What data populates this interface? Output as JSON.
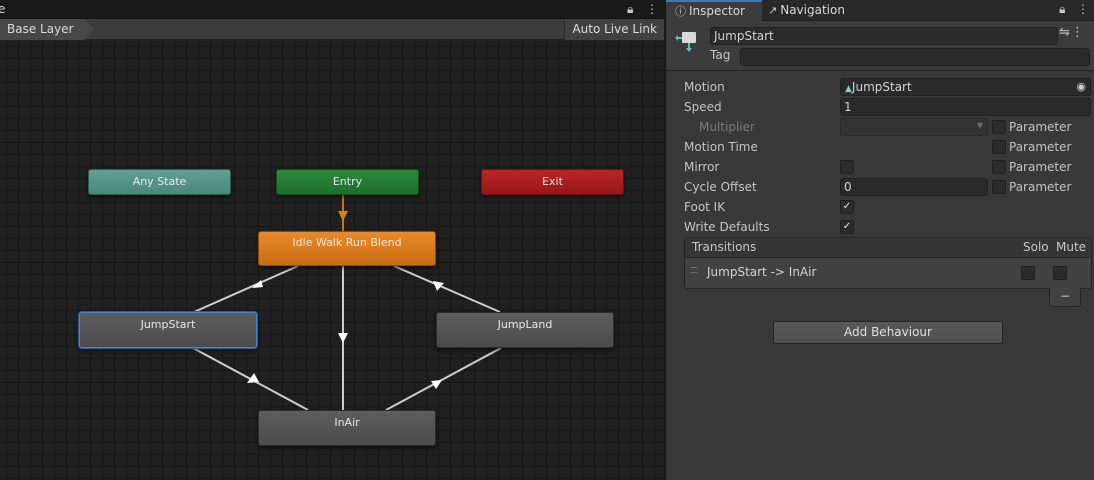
{
  "animator": {
    "tab_title": "e",
    "breadcrumb": "Base Layer",
    "auto_live_link": "Auto Live Link",
    "nodes": {
      "any_state": "Any State",
      "entry": "Entry",
      "exit": "Exit",
      "idle_walk_run": "Idle Walk Run Blend",
      "jump_start": "JumpStart",
      "jump_land": "JumpLand",
      "in_air": "InAir"
    }
  },
  "inspector": {
    "tab_inspector": "Inspector",
    "tab_navigation": "Navigation",
    "name": "JumpStart",
    "tag_label": "Tag",
    "tag_value": "",
    "props": {
      "motion_label": "Motion",
      "motion_value": "JumpStart",
      "speed_label": "Speed",
      "speed_value": "1",
      "multiplier_label": "Multiplier",
      "motion_time_label": "Motion Time",
      "mirror_label": "Mirror",
      "cycle_offset_label": "Cycle Offset",
      "cycle_offset_value": "0",
      "foot_ik_label": "Foot IK",
      "write_defaults_label": "Write Defaults",
      "parameter_label": "Parameter"
    },
    "checks": {
      "multiplier_param": false,
      "motion_time_param": false,
      "mirror": false,
      "mirror_param": false,
      "cycle_offset_param": false,
      "foot_ik": true,
      "write_defaults": true
    },
    "transitions": {
      "title": "Transitions",
      "solo": "Solo",
      "mute": "Mute",
      "items": [
        {
          "name": "JumpStart -> InAir",
          "solo": false,
          "mute": false
        }
      ],
      "remove_label": "−"
    },
    "add_behaviour": "Add Behaviour"
  },
  "colors": {
    "any_state": "#4f8f80",
    "entry": "#217a31",
    "exit": "#a61c1c",
    "default_state": "#d87b1d",
    "selection": "#3f88d4",
    "transition_line": "#d0d0d0"
  }
}
